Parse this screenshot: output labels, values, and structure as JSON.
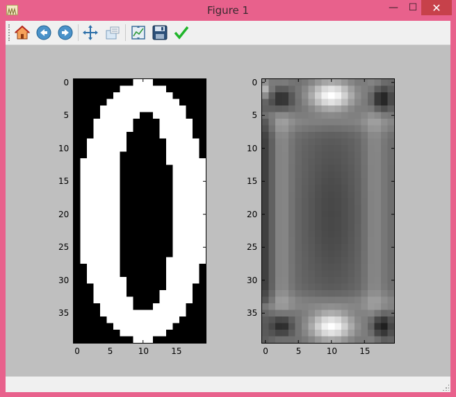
{
  "window": {
    "title": "Figure 1",
    "minimize_label": "—",
    "maximize_label": "☐",
    "close_label": "✕"
  },
  "toolbar": {
    "buttons": [
      {
        "name": "home",
        "icon": "home-icon"
      },
      {
        "name": "back",
        "icon": "back-arrow-icon"
      },
      {
        "name": "forward",
        "icon": "forward-arrow-icon"
      },
      {
        "name": "pan",
        "icon": "pan-move-icon"
      },
      {
        "name": "zoom",
        "icon": "zoom-rect-icon"
      },
      {
        "name": "subplots",
        "icon": "configure-subplots-icon"
      },
      {
        "name": "save",
        "icon": "save-disk-icon"
      },
      {
        "name": "edit",
        "icon": "edit-check-icon"
      }
    ]
  },
  "chart_data": [
    {
      "type": "heatmap",
      "colormap": "gray",
      "rows": 40,
      "cols": 20,
      "xticks": [
        "0",
        "5",
        "10",
        "15"
      ],
      "yticks": [
        "0",
        "5",
        "10",
        "15",
        "20",
        "25",
        "30",
        "35"
      ],
      "xlim": [
        -0.5,
        19.5
      ],
      "ylim": [
        39.5,
        -0.5
      ],
      "description_of_values": "binary digit image: white outer ring of a zero, black interior",
      "ring_outer": {
        "cx": 10,
        "cy": 19.5,
        "rx": 9.8,
        "ry": 19.8
      },
      "ring_inner": {
        "cx": 10.3,
        "cy": 19.8,
        "rx": 4.2,
        "ry": 15.2
      }
    },
    {
      "type": "heatmap",
      "colormap": "gray",
      "rows": 40,
      "cols": 20,
      "xticks": [
        "0",
        "5",
        "10",
        "15"
      ],
      "yticks": [
        "0",
        "5",
        "10",
        "15",
        "20",
        "25",
        "30",
        "35"
      ],
      "xlim": [
        -0.5,
        19.5
      ],
      "ylim": [
        39.5,
        -0.5
      ]
    }
  ]
}
